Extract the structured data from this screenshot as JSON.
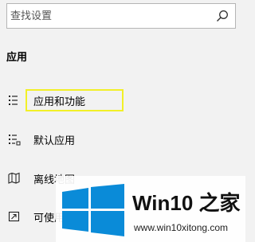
{
  "search": {
    "placeholder": "查找设置",
    "icon": "search-icon"
  },
  "section": {
    "title": "应用"
  },
  "nav": {
    "items": [
      {
        "label": "应用和功能",
        "icon": "list-icon",
        "highlighted": true
      },
      {
        "label": "默认应用",
        "icon": "default-apps-icon"
      },
      {
        "label": "离线地图",
        "icon": "map-icon"
      },
      {
        "label": "可使用",
        "icon": "open-with-icon"
      }
    ]
  },
  "watermark": {
    "title": "Win10 之家",
    "url": "www.win10xitong.com"
  },
  "colors": {
    "background": "#f2f2f2",
    "highlight": "#f2f028",
    "windows_blue": "#0a8bd8"
  }
}
